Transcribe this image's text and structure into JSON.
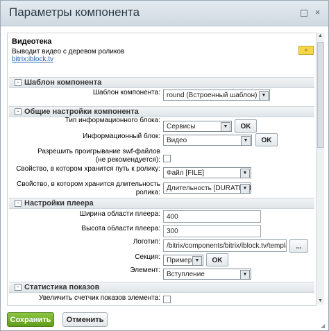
{
  "window": {
    "title": "Параметры компонента",
    "maximize_glyph": "",
    "close_glyph": "×"
  },
  "component": {
    "name": "Видеотека",
    "description": "Выводит видео с деревом роликов",
    "path": "bitrix:iblock.tv",
    "badge": "✧"
  },
  "sections": {
    "template": {
      "label": "Шаблон компонента",
      "toggle": "-"
    },
    "general": {
      "label": "Общие настройки компонента",
      "toggle": "-"
    },
    "player": {
      "label": "Настройки плеера",
      "toggle": "-"
    },
    "stats": {
      "label": "Статистика показов",
      "toggle": "-"
    }
  },
  "fields": {
    "template": {
      "label": "Шаблон компонента:",
      "value": "round (Встроенный шаблон)"
    },
    "iblock_type": {
      "label": "Тип информационного блока:",
      "value": "Сервисы",
      "ok": "OK"
    },
    "iblock": {
      "label": "Информационный блок:",
      "value": "Видео",
      "ok": "OK"
    },
    "allow_swf": {
      "label": "Разрешить проигрывание swf-файлов (не рекомендуется):"
    },
    "path_prop": {
      "label": "Свойство, в котором хранится путь к ролику:",
      "value": "Файл [FILE]"
    },
    "duration_prop": {
      "label": "Свойство, в котором хранится длительность ролика:",
      "value": "Длительность [DURATION]"
    },
    "width": {
      "label": "Ширина области плеера:",
      "value": "400"
    },
    "height": {
      "label": "Высота области плеера:",
      "value": "300"
    },
    "logo": {
      "label": "Логотип:",
      "value": "/bitrix/components/bitrix/iblock.tv/templates/.",
      "browse": "..."
    },
    "section": {
      "label": "Секция:",
      "value": "Примеры",
      "ok": "OK"
    },
    "element": {
      "label": "Элемент:",
      "value": "Вступление"
    },
    "increment_counter": {
      "label": "Увеличить счетчик показов элемента:"
    }
  },
  "footer": {
    "save": "Сохранить",
    "cancel": "Отменить"
  },
  "icons": {
    "select_arrow": "▼",
    "scroll_up": "▲",
    "scroll_down": "▼",
    "resize": "◢"
  }
}
